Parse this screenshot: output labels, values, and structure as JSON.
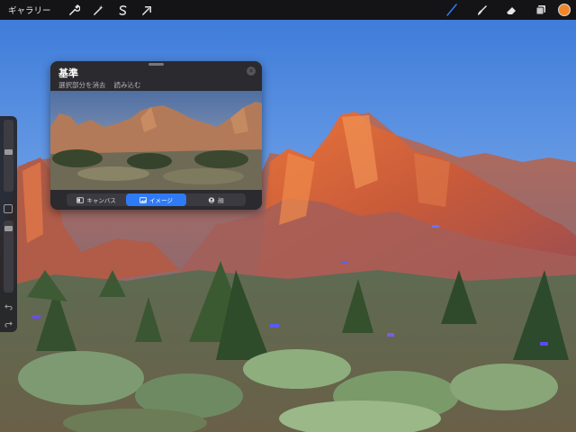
{
  "toolbar": {
    "gallery_label": "ギャラリー",
    "left_tools": [
      {
        "name": "actions",
        "icon": "wrench-icon"
      },
      {
        "name": "adjustments",
        "icon": "magic-wand-icon"
      },
      {
        "name": "selection",
        "icon": "selection-s-icon"
      },
      {
        "name": "transform",
        "icon": "arrow-cursor-icon"
      }
    ],
    "right_tools": [
      {
        "name": "brush",
        "icon": "brush-icon",
        "active": true
      },
      {
        "name": "smudge",
        "icon": "smudge-icon",
        "active": false
      },
      {
        "name": "eraser",
        "icon": "eraser-icon",
        "active": false
      },
      {
        "name": "layers",
        "icon": "layers-icon",
        "active": false
      }
    ],
    "current_color": "#f0862a",
    "active_tool_color": "#2f7af6"
  },
  "sidebar": {
    "brush_size_level": 0.3,
    "opacity_level": 0.1,
    "buttons": [
      {
        "name": "modify",
        "icon": "square-icon"
      },
      {
        "name": "undo",
        "icon": "undo-icon"
      },
      {
        "name": "redo",
        "icon": "redo-icon"
      }
    ]
  },
  "reference": {
    "title": "基準",
    "links": [
      "選択部分を消去",
      "読み込む"
    ],
    "segments": [
      {
        "label": "キャンバス",
        "icon": "canvas-toggle-icon",
        "active": false
      },
      {
        "label": "イメージ",
        "icon": "image-icon",
        "active": true
      },
      {
        "label": "顔",
        "icon": "face-icon",
        "active": false
      }
    ]
  }
}
